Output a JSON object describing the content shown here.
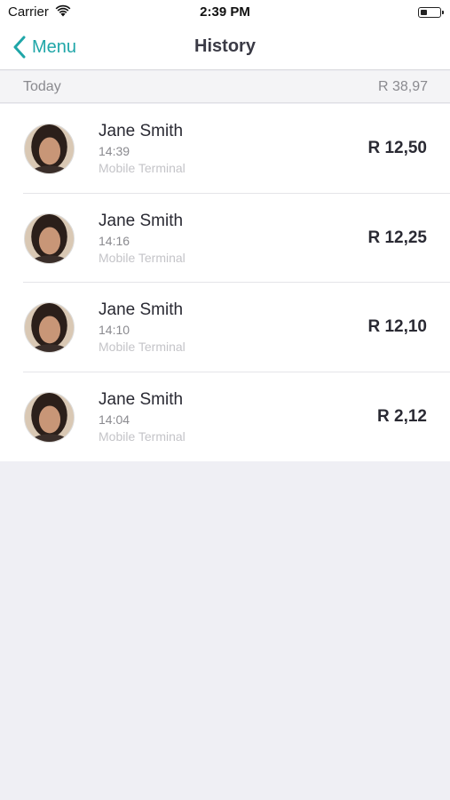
{
  "status_bar": {
    "carrier": "Carrier",
    "time": "2:39 PM",
    "battery_level": 0.35,
    "icons": [
      "wifi-icon",
      "battery-icon"
    ]
  },
  "nav": {
    "back_label": "Menu",
    "title": "History",
    "accent_color": "#1fa6a8",
    "back_icon": "chevron-left-icon"
  },
  "section": {
    "title": "Today",
    "total": "R 38,97"
  },
  "transactions": [
    {
      "name": "Jane Smith",
      "time": "14:39",
      "terminal": "Mobile Terminal",
      "amount": "R 12,50"
    },
    {
      "name": "Jane Smith",
      "time": "14:16",
      "terminal": "Mobile Terminal",
      "amount": "R 12,25"
    },
    {
      "name": "Jane Smith",
      "time": "14:10",
      "terminal": "Mobile Terminal",
      "amount": "R 12,10"
    },
    {
      "name": "Jane Smith",
      "time": "14:04",
      "terminal": "Mobile Terminal",
      "amount": "R 2,12"
    }
  ]
}
